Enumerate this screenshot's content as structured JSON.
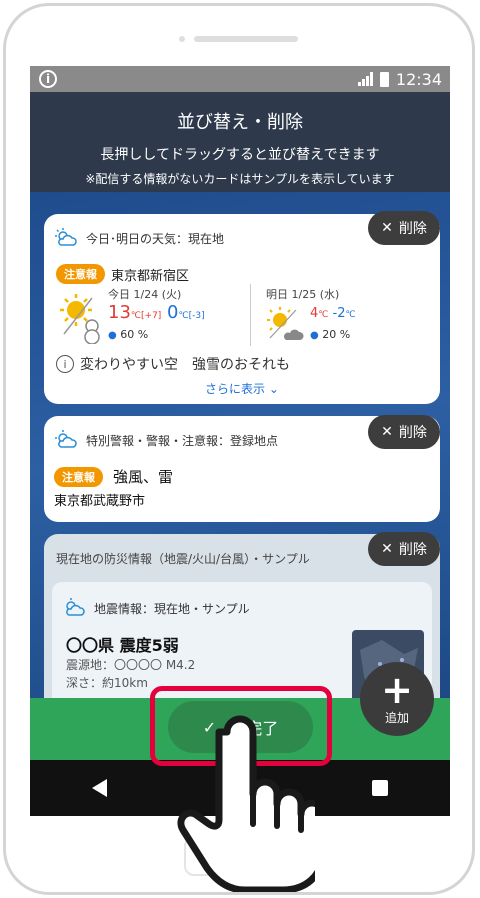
{
  "status_bar": {
    "time": "12:34",
    "info_glyph": "i"
  },
  "header": {
    "title": "並び替え・削除",
    "subtitle": "長押ししてドラッグすると並び替えできます",
    "note": "※配信する情報がないカードはサンプルを表示しています"
  },
  "delete_label": "削除",
  "card_weather": {
    "title": "今日･明日の天気：現在地",
    "badge": "注意報",
    "location": "東京都新宿区",
    "today": {
      "label": "今日 1/24 (火)",
      "max": "13",
      "max_diff": "[+7]",
      "min": "0",
      "min_diff": "[-3]",
      "unit": "℃",
      "pop": "60 %"
    },
    "tomorrow": {
      "label": "明日 1/25 (水)",
      "max": "4",
      "min": "-2",
      "unit": "℃",
      "pop": "20 %"
    },
    "note": "変わりやすい空　強雪のおそれも",
    "more": "さらに表示"
  },
  "card_warning": {
    "title": "特別警報・警報・注意報：登録地点",
    "badge": "注意報",
    "content": "強風、雷",
    "area": "東京都武蔵野市"
  },
  "card_disaster": {
    "title": "現在地の防災情報（地震/火山/台風）・サンプル",
    "inner_title": "地震情報：現在地・サンプル",
    "headline": "〇〇県 震度5弱",
    "epicenter": "震源地：〇〇〇〇 M4.2",
    "depth": "深さ：約10km"
  },
  "done_button": {
    "label": "完了",
    "check": "✓"
  },
  "add_button": {
    "plus": "+",
    "label": "追加"
  },
  "colors": {
    "accent_red": "#e3003c",
    "green": "#2fa55a",
    "badge_orange": "#f39700",
    "header": "#2e3a4b"
  }
}
